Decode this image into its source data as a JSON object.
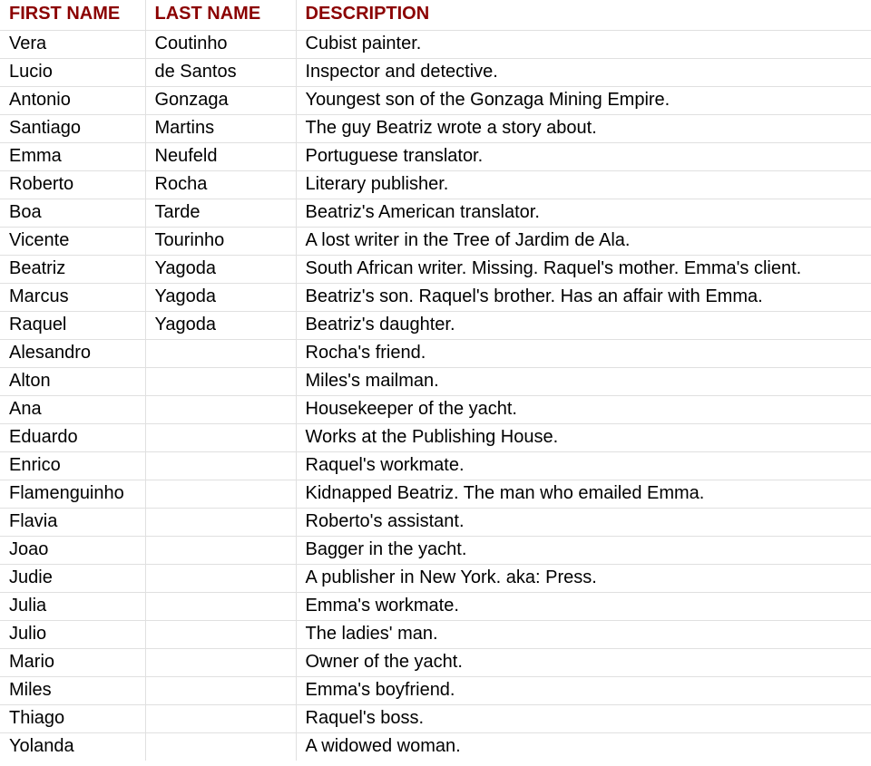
{
  "headers": {
    "first_name": "FIRST NAME",
    "last_name": "LAST NAME",
    "description": "DESCRIPTION"
  },
  "rows": [
    {
      "first": "Vera",
      "last": "Coutinho",
      "desc": "Cubist painter."
    },
    {
      "first": "Lucio",
      "last": "de Santos",
      "desc": "Inspector and detective."
    },
    {
      "first": "Antonio",
      "last": "Gonzaga",
      "desc": "Youngest son of the Gonzaga Mining Empire."
    },
    {
      "first": "Santiago",
      "last": "Martins",
      "desc": "The guy Beatriz wrote a story about."
    },
    {
      "first": "Emma",
      "last": "Neufeld",
      "desc": "Portuguese translator."
    },
    {
      "first": "Roberto",
      "last": "Rocha",
      "desc": "Literary publisher."
    },
    {
      "first": "Boa",
      "last": "Tarde",
      "desc": "Beatriz's American translator."
    },
    {
      "first": "Vicente",
      "last": "Tourinho",
      "desc": "A lost writer in the Tree of Jardim de Ala."
    },
    {
      "first": "Beatriz",
      "last": "Yagoda",
      "desc": "South African writer. Missing. Raquel's mother. Emma's client."
    },
    {
      "first": "Marcus",
      "last": "Yagoda",
      "desc": "Beatriz's son. Raquel's brother. Has an affair with Emma."
    },
    {
      "first": "Raquel",
      "last": "Yagoda",
      "desc": "Beatriz's daughter."
    },
    {
      "first": "Alesandro",
      "last": "",
      "desc": "Rocha's friend."
    },
    {
      "first": "Alton",
      "last": "",
      "desc": "Miles's mailman."
    },
    {
      "first": "Ana",
      "last": "",
      "desc": "Housekeeper of the yacht."
    },
    {
      "first": "Eduardo",
      "last": "",
      "desc": "Works at the Publishing House."
    },
    {
      "first": "Enrico",
      "last": "",
      "desc": "Raquel's workmate."
    },
    {
      "first": "Flamenguinho",
      "last": "",
      "desc": "Kidnapped Beatriz. The man who emailed Emma."
    },
    {
      "first": "Flavia",
      "last": "",
      "desc": "Roberto's assistant."
    },
    {
      "first": "Joao",
      "last": "",
      "desc": "Bagger in the yacht."
    },
    {
      "first": "Judie",
      "last": "",
      "desc": "A publisher in New York. aka: Press."
    },
    {
      "first": "Julia",
      "last": "",
      "desc": "Emma's workmate."
    },
    {
      "first": "Julio",
      "last": "",
      "desc": "The ladies' man."
    },
    {
      "first": "Mario",
      "last": "",
      "desc": "Owner of the yacht."
    },
    {
      "first": "Miles",
      "last": "",
      "desc": "Emma's boyfriend."
    },
    {
      "first": "Thiago",
      "last": "",
      "desc": "Raquel's boss."
    },
    {
      "first": "Yolanda",
      "last": "",
      "desc": "A widowed woman."
    }
  ]
}
